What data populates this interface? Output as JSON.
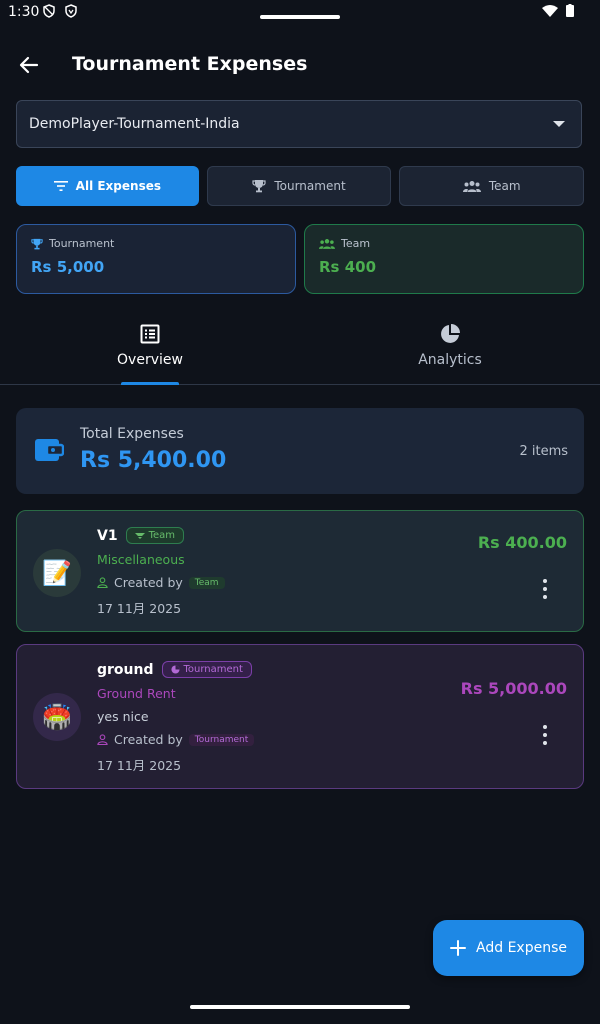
{
  "status_bar": {
    "time": "1:30"
  },
  "app_bar": {
    "title": "Tournament Expenses"
  },
  "tournament_select": {
    "value": "DemoPlayer-Tournament-India"
  },
  "filters": [
    {
      "label": "All Expenses",
      "active": true
    },
    {
      "label": "Tournament",
      "active": false
    },
    {
      "label": "Team",
      "active": false
    }
  ],
  "summary": {
    "tournament": {
      "label": "Tournament",
      "value": "Rs 5,000"
    },
    "team": {
      "label": "Team",
      "value": "Rs 400"
    }
  },
  "tabs": [
    {
      "label": "Overview",
      "active": true
    },
    {
      "label": "Analytics",
      "active": false
    }
  ],
  "total": {
    "label": "Total Expenses",
    "value": "Rs 5,400.00",
    "count": "2 items"
  },
  "expenses": [
    {
      "name": "V1",
      "type_label": "Team",
      "category": "Miscellaneous",
      "created_by": "Created by",
      "created_by_chip": "Team",
      "date": "17 11月 2025",
      "amount": "Rs 400.00",
      "avatar": "📝"
    },
    {
      "name": "ground",
      "type_label": "Tournament",
      "category": "Ground Rent",
      "note": "yes nice",
      "created_by": "Created by",
      "created_by_chip": "Tournament",
      "date": "17 11月 2025",
      "amount": "Rs 5,000.00",
      "avatar": "🏟️"
    }
  ],
  "fab": {
    "label": "Add Expense"
  },
  "colors": {
    "background": "#0e121a",
    "primary": "#1e88e5",
    "team_green": "#4caf50",
    "tournament_purple": "#ab47bc"
  }
}
